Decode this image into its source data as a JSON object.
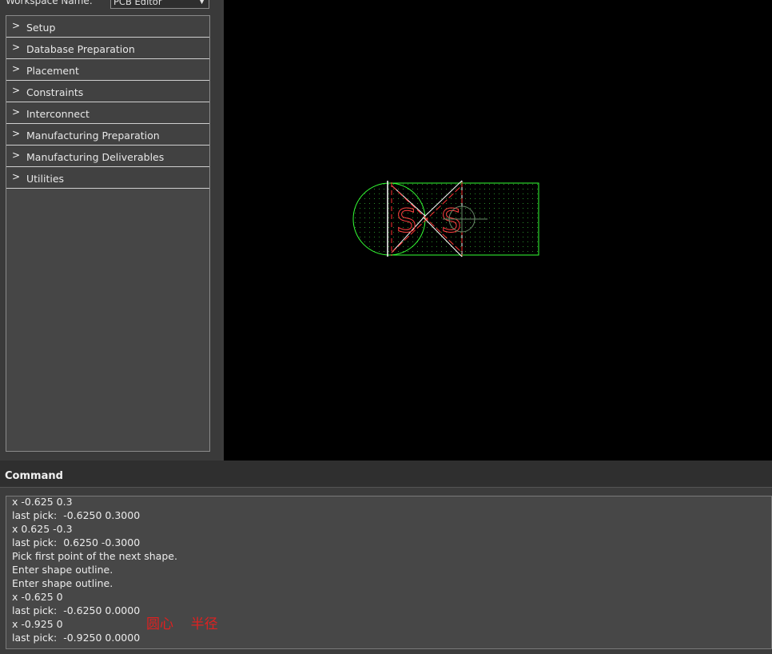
{
  "workspace": {
    "label": "Workspace Name:",
    "selected": "PCB Editor"
  },
  "flow_items": [
    {
      "label": "Setup"
    },
    {
      "label": "Database Preparation"
    },
    {
      "label": "Placement"
    },
    {
      "label": "Constraints"
    },
    {
      "label": "Interconnect"
    },
    {
      "label": "Manufacturing Preparation"
    },
    {
      "label": "Manufacturing Deliverables"
    },
    {
      "label": "Utilities"
    }
  ],
  "command": {
    "title": "Command",
    "lines": [
      "x -0.625 0.3",
      "last pick:  -0.6250 0.3000",
      "x 0.625 -0.3",
      "last pick:  0.6250 -0.3000",
      "Pick first point of the next shape.",
      "Enter shape outline.",
      "Enter shape outline.",
      "x -0.625 0",
      "last pick:  -0.6250 0.0000",
      "x -0.925 0",
      "last pick:  -0.9250 0.0000"
    ]
  },
  "annotation": {
    "text": "圆心    半径",
    "color": "#e02020"
  },
  "canvas": {
    "background": "#000000",
    "shape_color": "#33ff33",
    "accent_color": "#ff3030",
    "outline_color": "#ffffff",
    "silkscreen_text": [
      "S",
      "S"
    ]
  },
  "icons": {
    "chevron": "chevron-right-icon",
    "dropdown": "dropdown-arrow-icon"
  }
}
